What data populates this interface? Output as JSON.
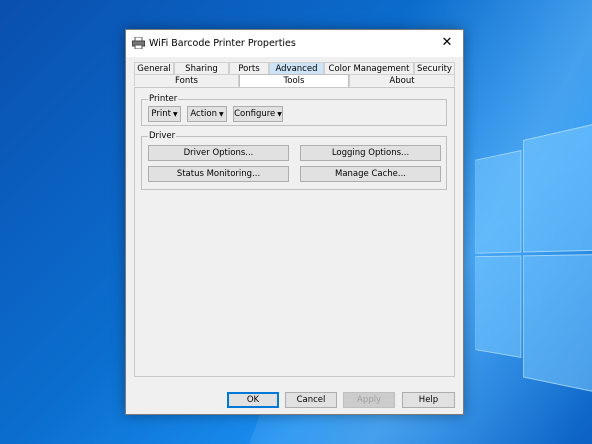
{
  "dialog": {
    "title": "WiFi Barcode Printer Properties",
    "close_glyph": "✕"
  },
  "tabs_row1": [
    {
      "label": "General"
    },
    {
      "label": "Sharing"
    },
    {
      "label": "Ports"
    },
    {
      "label": "Advanced"
    },
    {
      "label": "Color Management"
    },
    {
      "label": "Security"
    }
  ],
  "tabs_row2": [
    {
      "label": "Fonts"
    },
    {
      "label": "Tools"
    },
    {
      "label": "About"
    }
  ],
  "active_tab": "Tools",
  "printer_group": {
    "label": "Printer",
    "buttons": [
      {
        "label": "Print"
      },
      {
        "label": "Action"
      },
      {
        "label": "Configure"
      }
    ],
    "arrow_glyph": "▼"
  },
  "driver_group": {
    "label": "Driver",
    "buttons": [
      {
        "label": "Driver Options..."
      },
      {
        "label": "Logging Options..."
      },
      {
        "label": "Status Monitoring..."
      },
      {
        "label": "Manage Cache..."
      }
    ]
  },
  "footer": {
    "ok": "OK",
    "cancel": "Cancel",
    "apply": "Apply",
    "help": "Help"
  }
}
